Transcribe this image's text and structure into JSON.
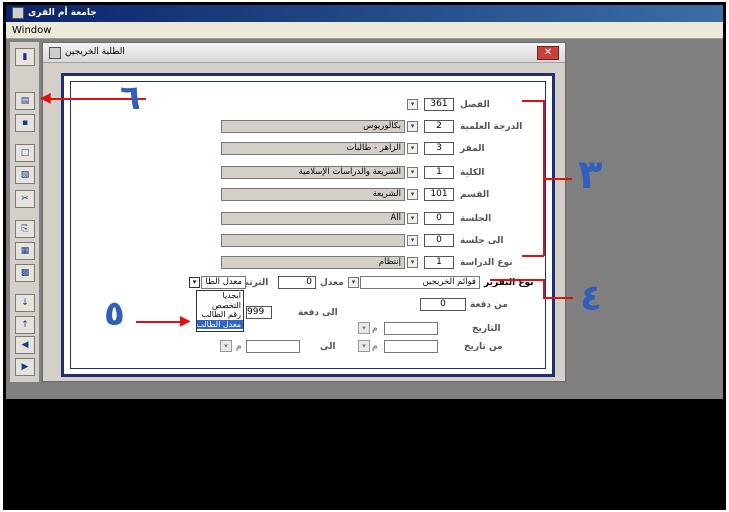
{
  "app": {
    "title": "جامعة أم القرى"
  },
  "menu": {
    "window": "Window"
  },
  "child": {
    "title": "الطلبة الخريجين",
    "close": "✕"
  },
  "fields": {
    "term": {
      "label": "الفصل",
      "value": "361"
    },
    "degree": {
      "label": "الدرجة العلمية",
      "value": "2",
      "name": "بكالوريوس"
    },
    "campus": {
      "label": "المقر",
      "value": "3",
      "name": "الزاهر - طالبات"
    },
    "college": {
      "label": "الكلية",
      "value": "1",
      "name": "الشريعة والدراسات الإسلامية"
    },
    "department": {
      "label": "القسم",
      "value": "101",
      "name": "الشريعة"
    },
    "session": {
      "label": "الجلسة",
      "value": "0",
      "name": "All"
    },
    "to_session": {
      "label": "الى جلسة",
      "value": "0",
      "name": ""
    },
    "study_type": {
      "label": "نوع الدراسة",
      "value": "1",
      "name": "إنتظام"
    }
  },
  "report": {
    "type_label": "نوع التقرير",
    "type_value": "قوائم الخريجين",
    "gpa_label": "معدل",
    "gpa_value": "0",
    "order_label": "الترتيب",
    "order_value": "معدل الطا",
    "options": [
      "ابجديا",
      "التخصص",
      "رقم الطالب",
      "معدل الطالب"
    ],
    "selected_index": 3
  },
  "batch": {
    "from_label": "من دفعة",
    "from_value": "0",
    "to_label": "الى دفعة",
    "to_value": "999"
  },
  "dates": {
    "date_label": "التاريخ",
    "from_date_label": "من تاريخ",
    "to_label": "الى",
    "m": "م"
  },
  "annotations": {
    "n3": "٣",
    "n4": "٤",
    "n5": "٥",
    "n6": "٦"
  }
}
